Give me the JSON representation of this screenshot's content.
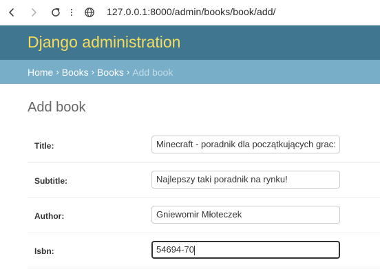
{
  "browser": {
    "url": "127.0.0.1:8000/admin/books/book/add/"
  },
  "header": {
    "site_title": "Django administration"
  },
  "breadcrumbs": {
    "items": [
      "Home",
      "Books",
      "Books"
    ],
    "separator": "›",
    "current": "Add book"
  },
  "main": {
    "page_title": "Add book",
    "fields": [
      {
        "label": "Title:",
        "value": "Minecraft - poradnik dla początkujących grac:"
      },
      {
        "label": "Subtitle:",
        "value": "Najlepszy taki poradnik na rynku!"
      },
      {
        "label": "Author:",
        "value": "Gniewomir Młoteczek"
      },
      {
        "label": "Isbn:",
        "value": "54694-70"
      }
    ]
  },
  "colors": {
    "header_bg": "#417690",
    "site_title": "#f5dd5d",
    "breadcrumbs_bg": "#79aec8"
  },
  "icons": [
    "back-arrow-icon",
    "forward-arrow-icon",
    "reload-icon",
    "more-vert-icon",
    "site-info-icon"
  ]
}
